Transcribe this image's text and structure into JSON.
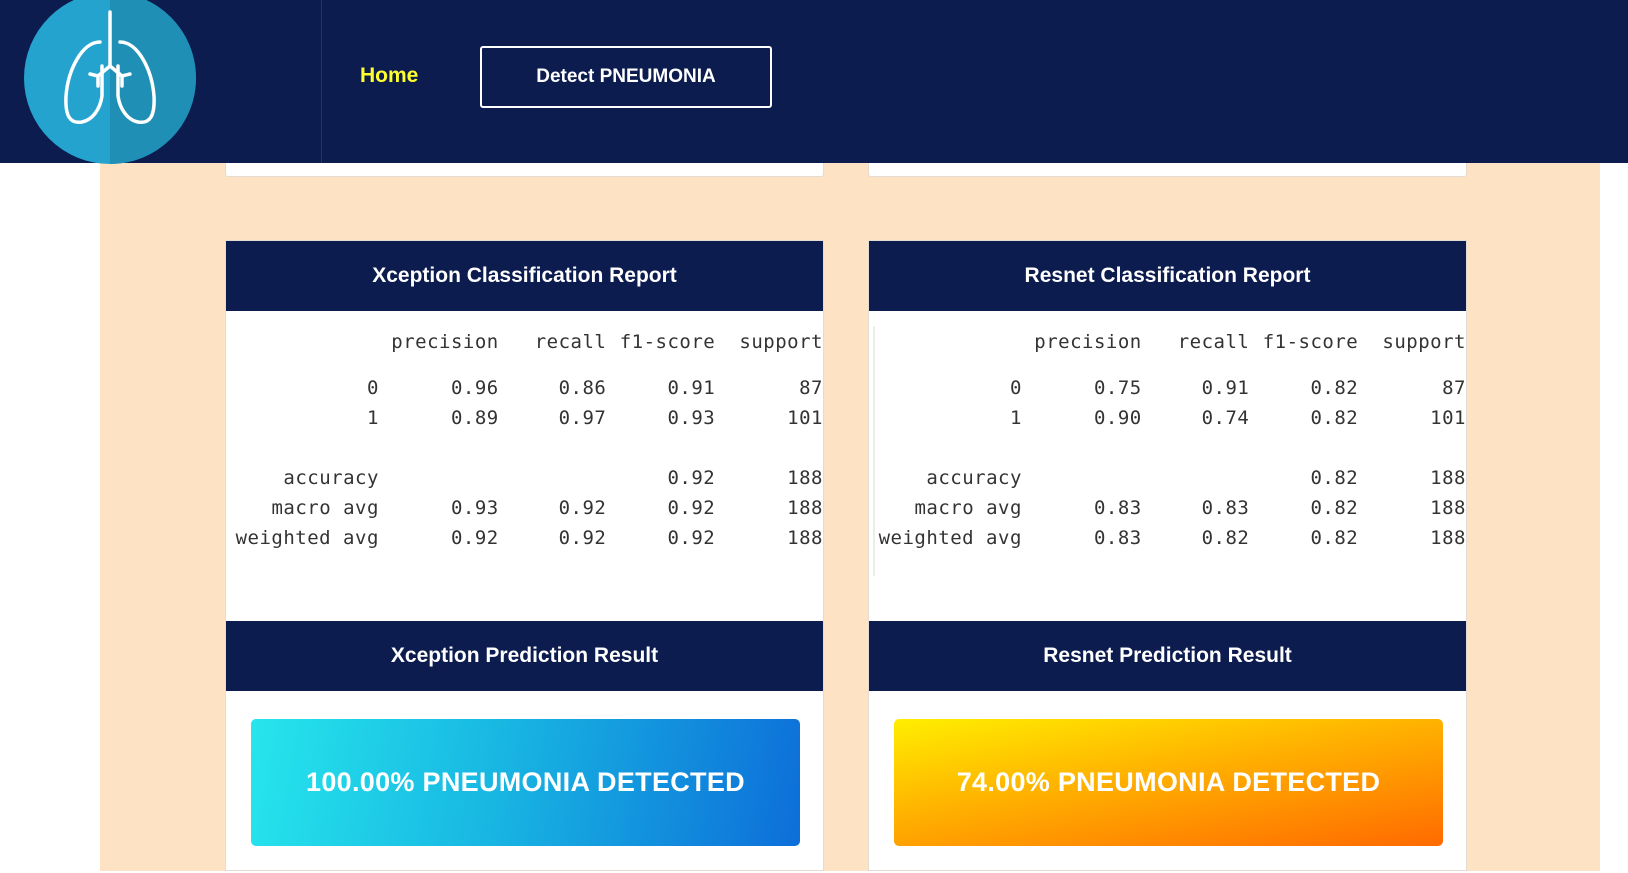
{
  "nav": {
    "logo_icon": "lungs-icon",
    "home_label": "Home",
    "detect_label": "Detect PNEUMONIA"
  },
  "colors": {
    "navy": "#0c1c4f",
    "peach": "#fde3c3",
    "home_yellow": "#ffff2e",
    "logo_blue": "#24a3cf"
  },
  "cards": [
    {
      "report_title": "Xception Classification Report",
      "report": {
        "header": [
          "",
          "precision",
          "recall",
          "f1-score",
          "support"
        ],
        "rows": [
          [
            "0",
            "0.96",
            "0.86",
            "0.91",
            "87"
          ],
          [
            "1",
            "0.89",
            "0.97",
            "0.93",
            "101"
          ],
          [
            "accuracy",
            "",
            "",
            "0.92",
            "188"
          ],
          [
            "macro avg",
            "0.93",
            "0.92",
            "0.92",
            "188"
          ],
          [
            "weighted avg",
            "0.92",
            "0.92",
            "0.92",
            "188"
          ]
        ]
      },
      "result_title": "Xception Prediction Result",
      "result_text": "100.00% PNEUMONIA DETECTED"
    },
    {
      "report_title": "Resnet Classification Report",
      "report": {
        "header": [
          "",
          "precision",
          "recall",
          "f1-score",
          "support"
        ],
        "rows": [
          [
            "0",
            "0.75",
            "0.91",
            "0.82",
            "87"
          ],
          [
            "1",
            "0.90",
            "0.74",
            "0.82",
            "101"
          ],
          [
            "accuracy",
            "",
            "",
            "0.82",
            "188"
          ],
          [
            "macro avg",
            "0.83",
            "0.83",
            "0.82",
            "188"
          ],
          [
            "weighted avg",
            "0.83",
            "0.82",
            "0.82",
            "188"
          ]
        ]
      },
      "result_title": "Resnet Prediction Result",
      "result_text": "74.00% PNEUMONIA DETECTED"
    }
  ]
}
